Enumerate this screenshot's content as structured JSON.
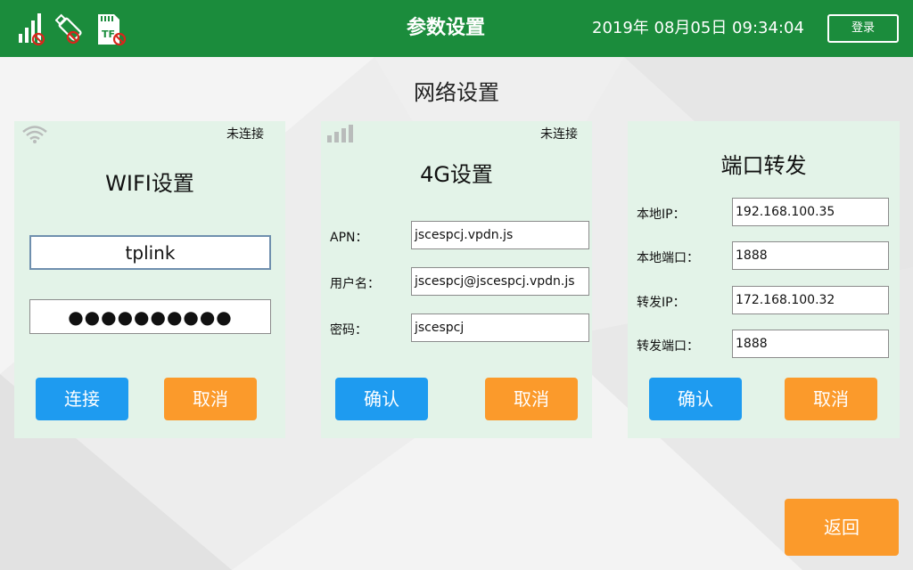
{
  "header": {
    "title": "参数设置",
    "datetime": "2019年 08月05日 09:34:04",
    "login_label": "登录",
    "status_icons": [
      "signal-off-icon",
      "usb-off-icon",
      "tf-card-off-icon"
    ],
    "sd_label": "TF"
  },
  "page_title": "网络设置",
  "wifi": {
    "status": "未连接",
    "title": "WIFI设置",
    "ssid": "tplink",
    "password": "●●●●●●●●●●",
    "connect_label": "连接",
    "cancel_label": "取消"
  },
  "lte": {
    "status": "未连接",
    "title": "4G设置",
    "apn_label": "APN：",
    "apn_value": "jscespcj.vpdn.js",
    "user_label": "用户名：",
    "user_value": "jscespcj@jscespcj.vpdn.js",
    "pwd_label": "密码：",
    "pwd_value": "jscespcj",
    "confirm_label": "确认",
    "cancel_label": "取消"
  },
  "port": {
    "title": "端口转发",
    "local_ip_label": "本地IP：",
    "local_ip": "192.168.100.35",
    "local_port_label": "本地端口：",
    "local_port": "1888",
    "fwd_ip_label": "转发IP：",
    "fwd_ip": "172.168.100.32",
    "fwd_port_label": "转发端口：",
    "fwd_port": "1888",
    "confirm_label": "确认",
    "cancel_label": "取消"
  },
  "back_label": "返回",
  "colors": {
    "header": "#1b8c3c",
    "panel": "#e3f3e8",
    "blue_button": "#1e9bf0",
    "orange_button": "#fb9a2b"
  }
}
